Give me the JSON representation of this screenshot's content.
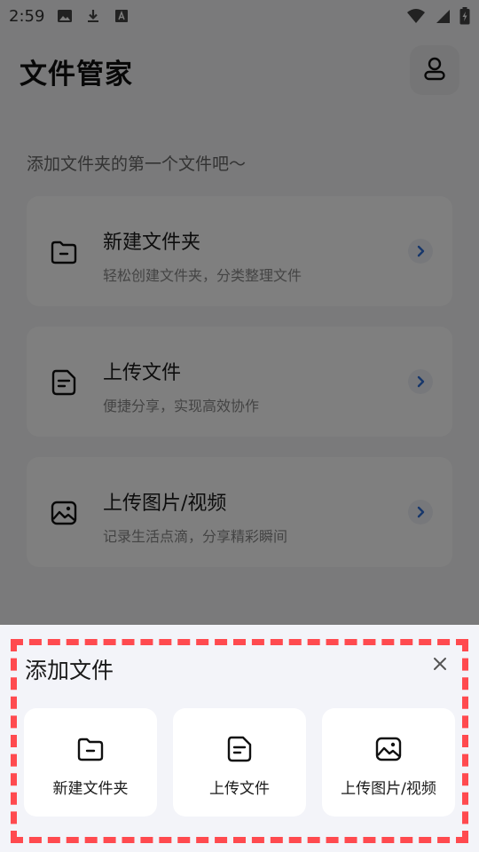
{
  "status_bar": {
    "time": "2:59",
    "icons": [
      "image-icon",
      "download-icon",
      "font-a-icon",
      "wifi-icon",
      "signal-icon",
      "battery-charging-icon"
    ]
  },
  "header": {
    "title": "文件管家",
    "profile_icon": "user-icon"
  },
  "main": {
    "empty_hint": "添加文件夹的第一个文件吧～",
    "cards": [
      {
        "icon": "folder-icon",
        "title": "新建文件夹",
        "description": "轻松创建文件夹，分类整理文件"
      },
      {
        "icon": "document-icon",
        "title": "上传文件",
        "description": "便捷分享，实现高效协作"
      },
      {
        "icon": "image-icon",
        "title": "上传图片/视频",
        "description": "记录生活点滴，分享精彩瞬间"
      }
    ]
  },
  "sheet": {
    "title": "添加文件",
    "close_icon": "close-icon",
    "options": [
      {
        "icon": "folder-icon",
        "label": "新建文件夹"
      },
      {
        "icon": "document-icon",
        "label": "上传文件"
      },
      {
        "icon": "image-icon",
        "label": "上传图片/视频"
      }
    ]
  },
  "colors": {
    "accent": "#2f6fd6",
    "highlight": "#ff4a4f",
    "sheet_background": "#f3f4f9"
  }
}
